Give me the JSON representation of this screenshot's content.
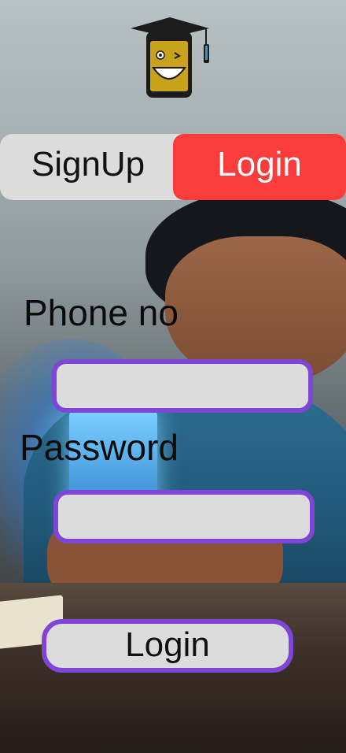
{
  "tabs": {
    "signup_label": "SignUp",
    "login_label": "Login",
    "active": "Login"
  },
  "form": {
    "phone_label": "Phone no",
    "phone_value": "",
    "password_label": "Password",
    "password_value": "",
    "submit_label": "Login"
  },
  "logo": {
    "icon": "graduation-phone-mascot-icon"
  },
  "colors": {
    "accent_red": "#fb3c3c",
    "field_border": "#7e45d6",
    "field_fill": "#dcdcdc"
  }
}
